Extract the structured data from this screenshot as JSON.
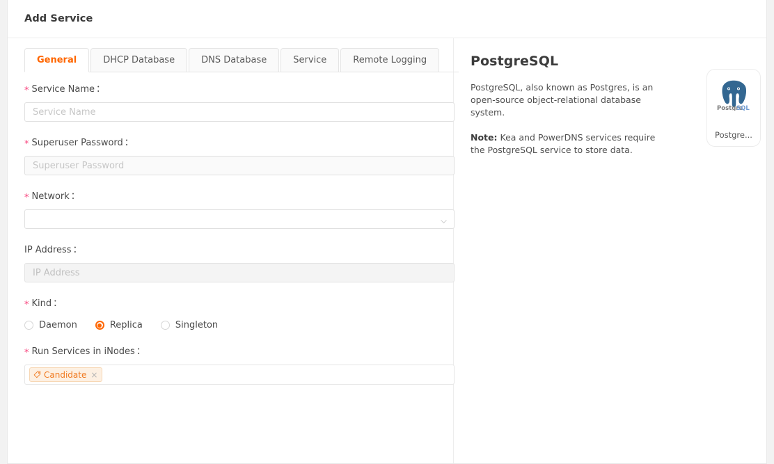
{
  "header": {
    "title": "Add Service"
  },
  "tabs": [
    {
      "label": "General",
      "active": true
    },
    {
      "label": "DHCP Database",
      "active": false
    },
    {
      "label": "DNS Database",
      "active": false
    },
    {
      "label": "Service",
      "active": false
    },
    {
      "label": "Remote Logging",
      "active": false
    }
  ],
  "form": {
    "service_name": {
      "label": "Service Name",
      "required": true,
      "value": "",
      "placeholder": "Service Name"
    },
    "superuser_password": {
      "label": "Superuser Password",
      "required": true,
      "value": "",
      "placeholder": "Superuser Password"
    },
    "network": {
      "label": "Network",
      "required": true,
      "value": "",
      "placeholder": ""
    },
    "ip_address": {
      "label": "IP Address",
      "required": false,
      "value": "",
      "placeholder": "IP Address"
    },
    "kind": {
      "label": "Kind",
      "required": true,
      "selected": "Replica",
      "options": [
        "Daemon",
        "Replica",
        "Singleton"
      ]
    },
    "run_services_in_inodes": {
      "label": "Run Services in iNodes",
      "required": true,
      "tags": [
        {
          "label": "Candidate",
          "icon": "tag-icon",
          "close": "×"
        }
      ]
    },
    "colon": "：",
    "required_marker": "*"
  },
  "detail": {
    "title": "PostgreSQL",
    "description": "PostgreSQL, also known as Postgres, is an open-source object-relational database system.",
    "note_label": "Note:",
    "note_text": " Kea and PowerDNS services require the PostgreSQL service to store data.",
    "logo_caption": "Postgre...",
    "logo_wordmark_left": "Postgre",
    "logo_wordmark_right": "SQL"
  },
  "colors": {
    "accent": "#ff6600",
    "required": "#f8467f",
    "tag_text": "#f07a20",
    "tag_bg": "#fdf0e2",
    "postgres_blue": "#336791"
  }
}
